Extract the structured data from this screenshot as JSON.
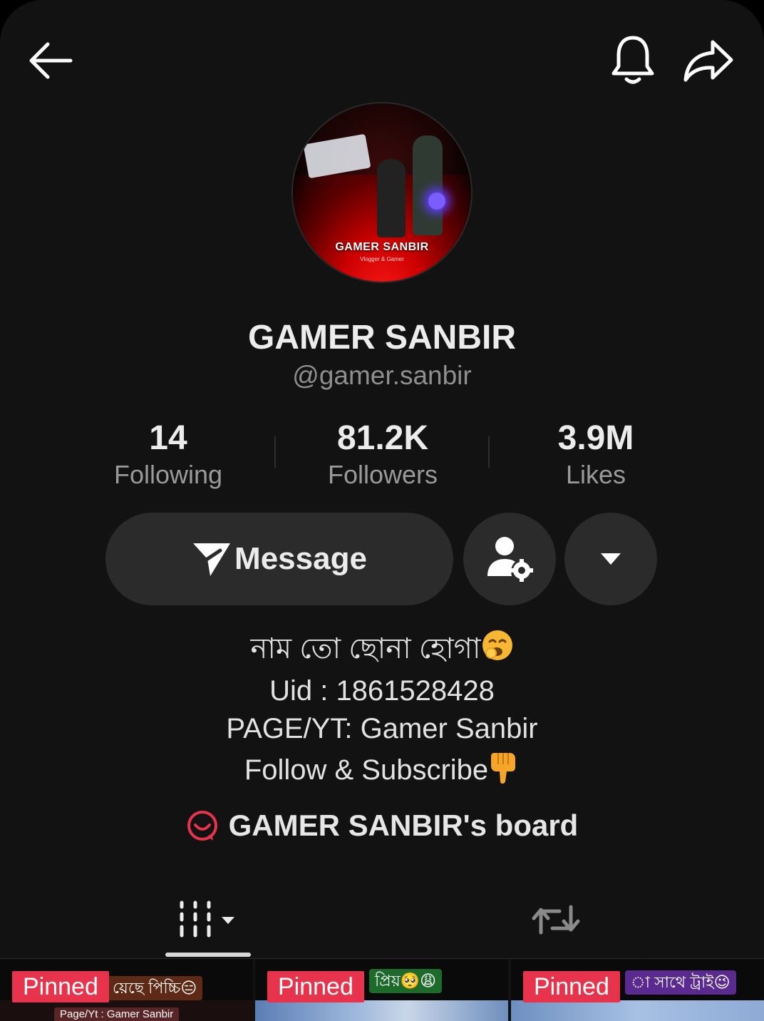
{
  "profile": {
    "display_name": "GAMER SANBIR",
    "username": "@gamer.sanbir",
    "avatar_text": "GAMER SANBIR",
    "avatar_subtext": "Vlogger & Gamer"
  },
  "stats": {
    "following": {
      "value": "14",
      "label": "Following"
    },
    "followers": {
      "value": "81.2K",
      "label": "Followers"
    },
    "likes": {
      "value": "3.9M",
      "label": "Likes"
    }
  },
  "actions": {
    "message_label": "Message"
  },
  "bio": {
    "line1": "নাম তো ছোনা হোগা",
    "line1_emoji": "yawning-face",
    "line2": "Uid : 1861528428",
    "line3": "PAGE/YT: Gamer Sanbir",
    "line4": "Follow & Subscribe",
    "line4_emoji": "backhand-index-pointing-down"
  },
  "board": {
    "label": "GAMER SANBIR's board"
  },
  "tabs": {
    "active": "videos",
    "items": [
      {
        "name": "videos",
        "icon": "grid-columns-icon"
      },
      {
        "name": "reposts",
        "icon": "repost-icon"
      }
    ]
  },
  "videos": [
    {
      "badge": "Pinned",
      "caption": "য়েছে পিচ্চি😑",
      "footer": "Page/Yt : Gamer Sanbir"
    },
    {
      "badge": "Pinned",
      "caption": "প্রিয়🥺😩"
    },
    {
      "badge": "Pinned",
      "caption": "া সাথে ট্রাই😉"
    }
  ],
  "colors": {
    "background": "#121212",
    "button_bg": "#2b2b2b",
    "pinned_badge": "#e8334c",
    "board_icon": "#e8334c"
  }
}
